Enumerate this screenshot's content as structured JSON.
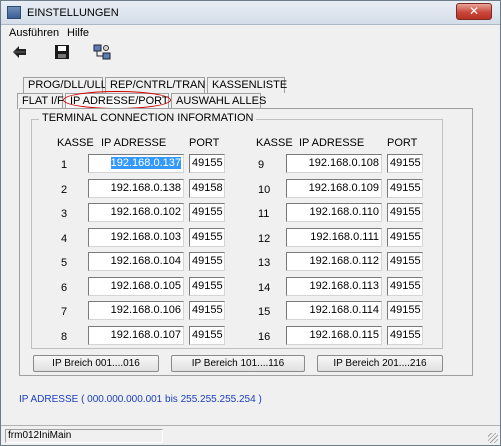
{
  "window": {
    "title": "EINSTELLUNGEN",
    "close_label": "✕"
  },
  "menu": {
    "items": [
      "Ausführen",
      "Hilfe"
    ]
  },
  "toolbar": {
    "icons": [
      "back-arrow-icon",
      "save-disk-icon",
      "network-config-icon"
    ]
  },
  "tabs": {
    "row1": [
      "PROG/DLL/ULL",
      "REP/CNTRL/TRAN",
      "KASSENLISTE"
    ],
    "row2": [
      "FLAT I/F",
      "IP ADRESSE/PORT",
      "AUSWAHL ALLES"
    ],
    "active": "IP ADRESSE/PORT"
  },
  "group": {
    "title": "TERMINAL CONNECTION INFORMATION",
    "headers": {
      "kasse": "KASSE",
      "ip": "IP ADRESSE",
      "port": "PORT"
    }
  },
  "terminals_left": [
    {
      "kasse": "1",
      "ip": "192.168.0.137",
      "port": "49155",
      "selected": true
    },
    {
      "kasse": "2",
      "ip": "192.168.0.138",
      "port": "49158"
    },
    {
      "kasse": "3",
      "ip": "192.168.0.102",
      "port": "49155"
    },
    {
      "kasse": "4",
      "ip": "192.168.0.103",
      "port": "49155"
    },
    {
      "kasse": "5",
      "ip": "192.168.0.104",
      "port": "49155"
    },
    {
      "kasse": "6",
      "ip": "192.168.0.105",
      "port": "49155"
    },
    {
      "kasse": "7",
      "ip": "192.168.0.106",
      "port": "49155"
    },
    {
      "kasse": "8",
      "ip": "192.168.0.107",
      "port": "49155"
    }
  ],
  "terminals_right": [
    {
      "kasse": "9",
      "ip": "192.168.0.108",
      "port": "49155"
    },
    {
      "kasse": "10",
      "ip": "192.168.0.109",
      "port": "49155"
    },
    {
      "kasse": "11",
      "ip": "192.168.0.110",
      "port": "49155"
    },
    {
      "kasse": "12",
      "ip": "192.168.0.111",
      "port": "49155"
    },
    {
      "kasse": "13",
      "ip": "192.168.0.112",
      "port": "49155"
    },
    {
      "kasse": "14",
      "ip": "192.168.0.113",
      "port": "49155"
    },
    {
      "kasse": "15",
      "ip": "192.168.0.114",
      "port": "49155"
    },
    {
      "kasse": "16",
      "ip": "192.168.0.115",
      "port": "49155"
    }
  ],
  "range_buttons": [
    "IP Breich 001....016",
    "IP Bereich 101....116",
    "IP Bereich 201....216"
  ],
  "info_text": "IP ADRESSE ( 000.000.000.001 bis 255.255.255.254 )",
  "status": {
    "form_name": "frm012IniMain"
  },
  "colors": {
    "selection": "#3399ff",
    "info_text": "#1a3fbf",
    "highlight_ellipse": "#d00000"
  }
}
